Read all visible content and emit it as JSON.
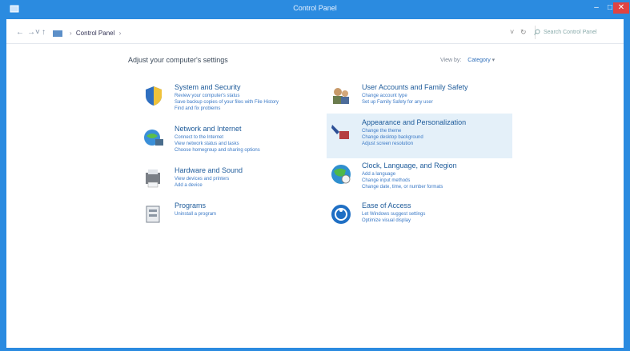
{
  "window": {
    "title": "Control Panel"
  },
  "address": {
    "breadcrumb": [
      "Control Panel"
    ],
    "search_placeholder": "Search Control Panel"
  },
  "heading": "Adjust your computer's settings",
  "view_by": {
    "label": "View by:",
    "value": "Category"
  },
  "categories": [
    {
      "title": "System and Security",
      "links": [
        "Review your computer's status",
        "Save backup copies of your files with File History",
        "Find and fix problems"
      ]
    },
    {
      "title": "Network and Internet",
      "links": [
        "Connect to the Internet",
        "View network status and tasks",
        "Choose homegroup and sharing options"
      ]
    },
    {
      "title": "Hardware and Sound",
      "links": [
        "View devices and printers",
        "Add a device"
      ]
    },
    {
      "title": "Programs",
      "links": [
        "Uninstall a program"
      ]
    },
    {
      "title": "User Accounts and Family Safety",
      "links": [
        "Change account type",
        "Set up Family Safety for any user"
      ]
    },
    {
      "title": "Appearance and Personalization",
      "links": [
        "Change the theme",
        "Change desktop background",
        "Adjust screen resolution"
      ]
    },
    {
      "title": "Clock, Language, and Region",
      "links": [
        "Add a language",
        "Change input methods",
        "Change date, time, or number formats"
      ]
    },
    {
      "title": "Ease of Access",
      "links": [
        "Let Windows suggest settings",
        "Optimize visual display"
      ]
    }
  ],
  "colors": {
    "frame": "#2b8be0",
    "link": "#3a79c6",
    "title": "#1e5b9a",
    "close": "#e04343",
    "highlight": "#e4f0f9"
  },
  "icons": [
    "shield-icon",
    "globe-network-icon",
    "printer-speaker-icon",
    "programs-icon",
    "users-icon",
    "paintbrush-icon",
    "globe-clock-icon",
    "ease-of-access-icon"
  ]
}
